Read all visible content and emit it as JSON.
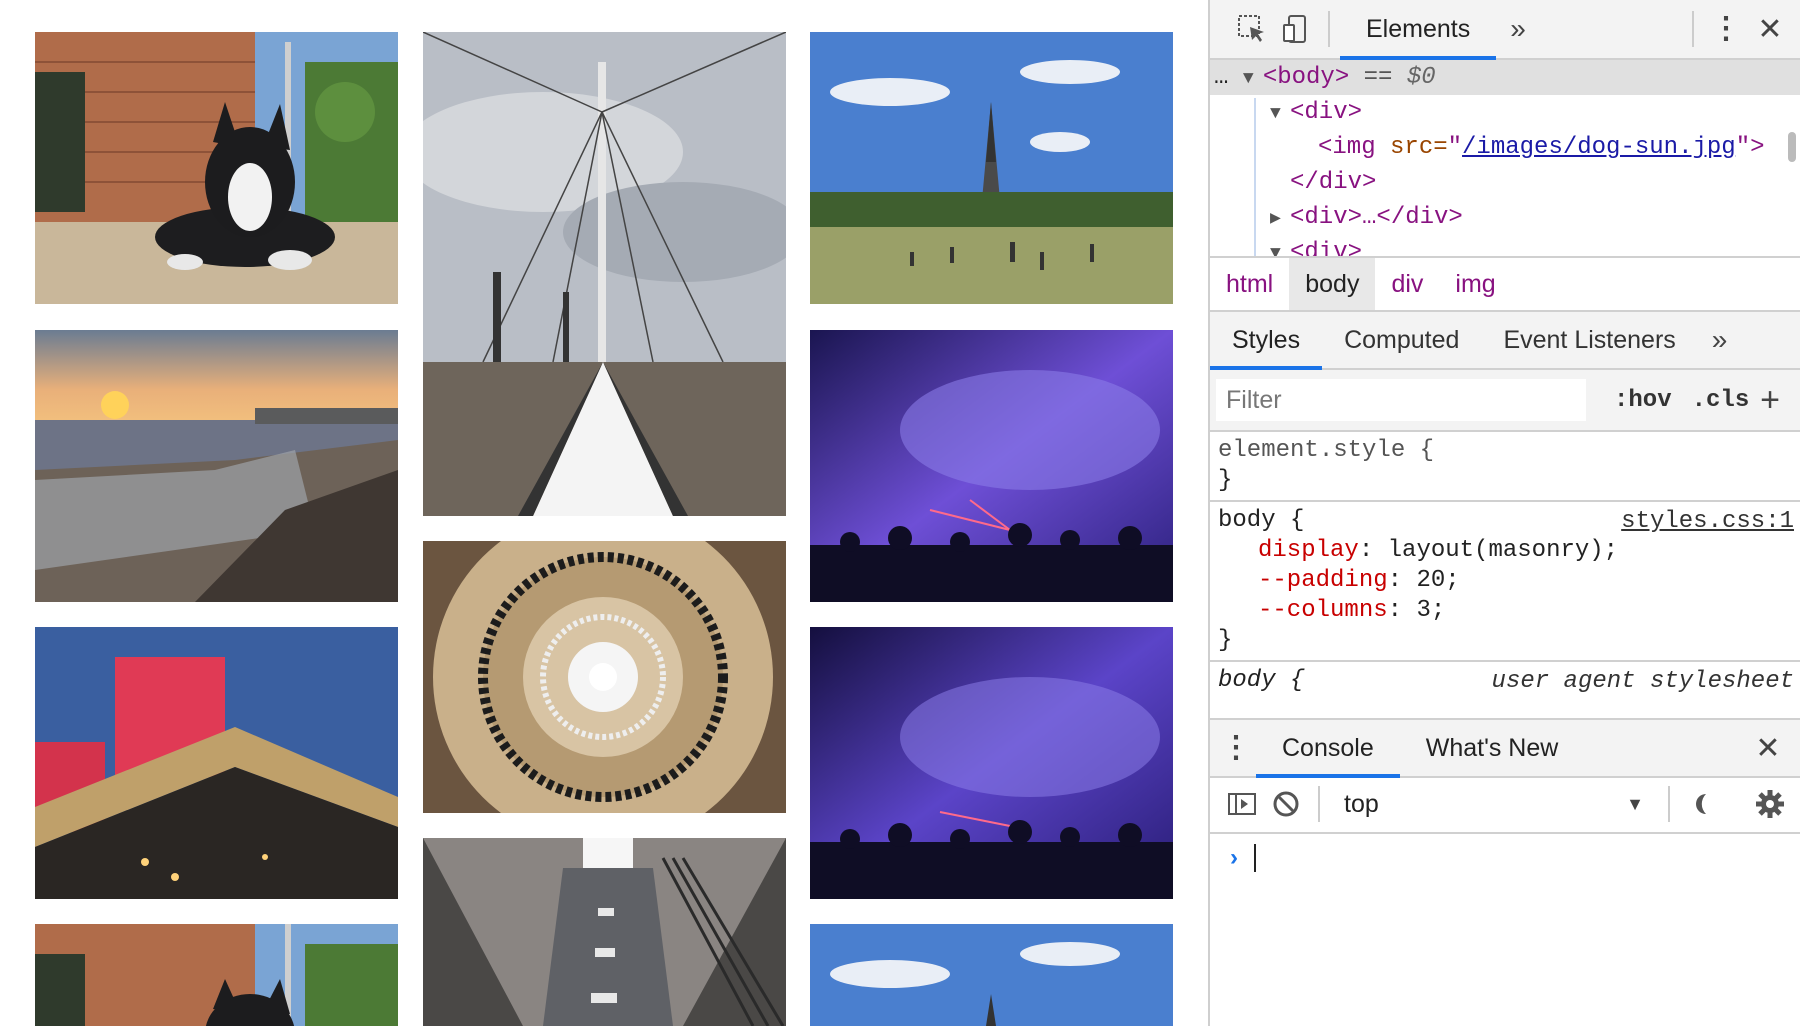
{
  "images": [
    {
      "name": "dog-sun-image-1",
      "alt": "dog in the sun"
    },
    {
      "name": "bridge-image",
      "alt": "suspension bridge walkway"
    },
    {
      "name": "eiffel-tower-image-1",
      "alt": "Eiffel tower park"
    },
    {
      "name": "beach-sunset-image",
      "alt": "beach at sunset"
    },
    {
      "name": "concert-lasers-image-1",
      "alt": "concert with lasers"
    },
    {
      "name": "spiral-staircase-image",
      "alt": "spiral staircase"
    },
    {
      "name": "red-building-image",
      "alt": "red lit building"
    },
    {
      "name": "concert-lasers-image-2",
      "alt": "concert with lasers"
    },
    {
      "name": "tunnel-image",
      "alt": "underground tunnel"
    },
    {
      "name": "dog-sun-image-2",
      "alt": "dog in the sun"
    },
    {
      "name": "eiffel-tower-image-2",
      "alt": "Eiffel tower park"
    }
  ],
  "devtools": {
    "toolbar": {
      "inspect_icon": "inspect-element-icon",
      "device_icon": "device-toolbar-icon",
      "tab_elements": "Elements",
      "more_tabs": "»",
      "menu": "⋮",
      "close": "✕"
    },
    "dom": {
      "ellipsis": "…",
      "body_tag": "<body>",
      "eq_sign": "==",
      "dollar": "$0",
      "div_open": "<div>",
      "img_tag": "<img",
      "src_attr": " src=",
      "src_val": "/images/dog-sun.jpg",
      "img_close": ">",
      "div_close": "</div>",
      "div_collapsed": "<div>…</div>",
      "div_open2": "<div>"
    },
    "breadcrumbs": [
      "html",
      "body",
      "div",
      "img"
    ],
    "panel_tabs": {
      "styles": "Styles",
      "computed": "Computed",
      "event_listeners": "Event Listeners",
      "more": "»"
    },
    "filter": {
      "placeholder": "Filter",
      "hov": ":hov",
      "cls": ".cls",
      "add": "+"
    },
    "rules": {
      "element_style_selector": "element.style {",
      "close_brace": "}",
      "body_selector": "body {",
      "body_source": "styles.css:1",
      "decls": [
        {
          "prop": "display",
          "value": "layout(masonry);"
        },
        {
          "prop": "--padding",
          "value": "20;"
        },
        {
          "prop": "--columns",
          "value": "3;"
        }
      ],
      "ua_selector": "body {",
      "ua_source": "user agent stylesheet"
    },
    "drawer": {
      "menu": "⋮",
      "tab_console": "Console",
      "tab_whats_new": "What's New",
      "close": "✕",
      "context": "top",
      "dropdown_arrow": "▼",
      "prompt": "›"
    }
  }
}
